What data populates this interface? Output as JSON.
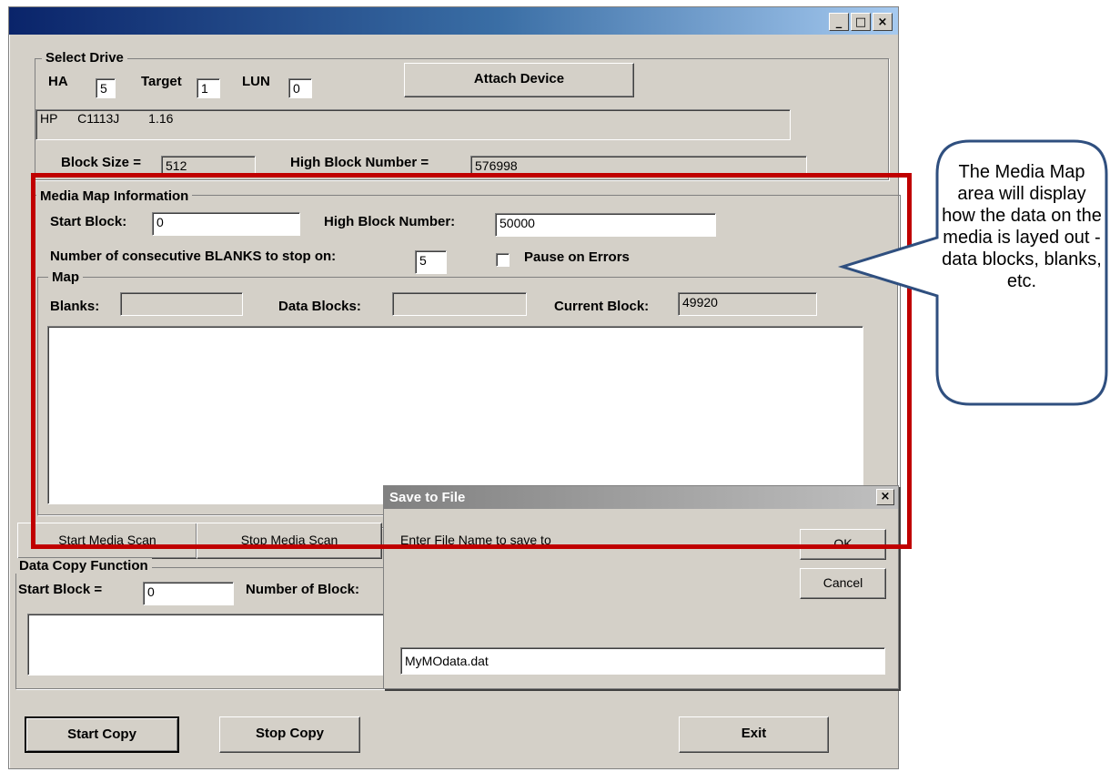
{
  "window": {
    "buttons": [
      "_",
      "□",
      "×"
    ]
  },
  "select_drive": {
    "title": "Select Drive",
    "ha_label": "HA",
    "ha_value": "5",
    "target_label": "Target",
    "target_value": "1",
    "lun_label": "LUN",
    "lun_value": "0",
    "attach_button": "Attach Device",
    "device_vendor": "HP",
    "device_model": "C1113J",
    "device_rev": "1.16",
    "block_size_label": "Block Size =",
    "block_size_value": "512",
    "high_block_label": "High Block Number =",
    "high_block_value": "576998"
  },
  "media_map": {
    "title": "Media Map Information",
    "start_block_label": "Start Block:",
    "start_block_value": "0",
    "high_block_label": "High Block Number:",
    "high_block_value": "50000",
    "blanks_stop_label": "Number of consecutive BLANKS to stop on:",
    "blanks_stop_value": "5",
    "pause_label": "Pause on Errors",
    "map_title": "Map",
    "blanks_label": "Blanks:",
    "blanks_value": "",
    "data_blocks_label": "Data Blocks:",
    "data_blocks_value": "",
    "current_block_label": "Current Block:",
    "current_block_value": "49920",
    "start_scan_button": "Start Media Scan",
    "stop_scan_button": "Stop Media Scan"
  },
  "data_copy": {
    "title": "Data Copy Function",
    "start_block_label": "Start Block =",
    "start_block_value": "0",
    "num_blocks_label": "Number of Block:",
    "start_copy_button": "Start Copy",
    "stop_copy_button": "Stop Copy",
    "exit_button": "Exit"
  },
  "save_dialog": {
    "title": "Save to File",
    "close": "×",
    "prompt": "Enter File Name to save to",
    "ok_button": "OK",
    "cancel_button": "Cancel",
    "filename_value": "MyMOdata.dat"
  },
  "callout": {
    "text": "The Media Map area will display how the data on the media is layed out - data blocks, blanks, etc."
  },
  "colors": {
    "highlight": "#c00000",
    "callout_border": "#2f4f7f",
    "title_gradient_start": "#0a246a"
  }
}
